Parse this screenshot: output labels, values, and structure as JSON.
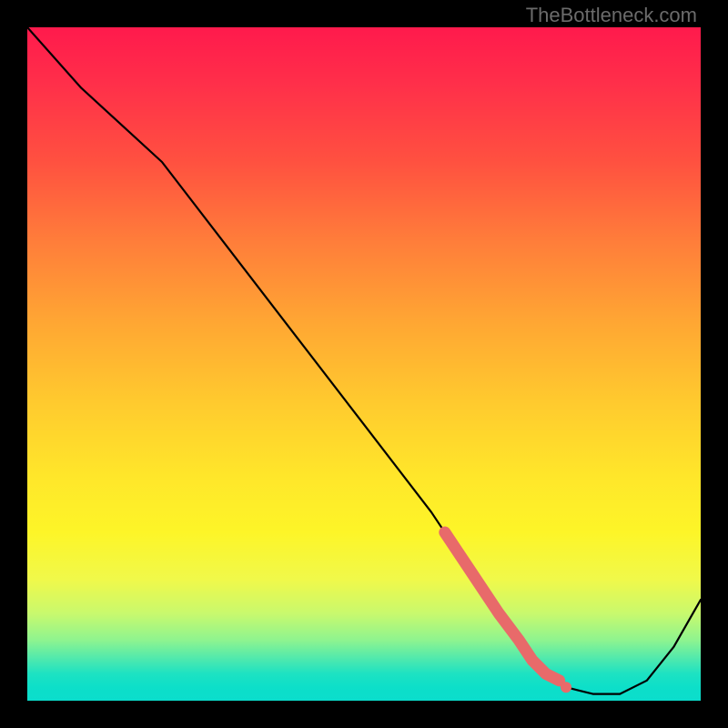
{
  "watermark": "TheBottleneck.com",
  "chart_data": {
    "type": "line",
    "title": "",
    "xlabel": "",
    "ylabel": "",
    "xlim": [
      0,
      100
    ],
    "ylim": [
      0,
      100
    ],
    "series": [
      {
        "name": "bottleneck-curve",
        "x": [
          0,
          8,
          20,
          30,
          40,
          50,
          60,
          68,
          73,
          76,
          80,
          84,
          88,
          92,
          96,
          100
        ],
        "values": [
          100,
          91,
          80,
          67,
          54,
          41,
          28,
          16,
          9,
          5,
          2,
          1,
          1,
          3,
          8,
          15
        ]
      }
    ],
    "highlight_segment": {
      "description": "pink emphasized band on descending part near trough",
      "x": [
        62,
        66,
        70,
        73,
        75,
        77,
        79
      ],
      "values": [
        25,
        19,
        13,
        9,
        6,
        4,
        3
      ]
    },
    "highlight_dots": [
      {
        "x": 73,
        "y": 9
      },
      {
        "x": 77,
        "y": 4
      },
      {
        "x": 80,
        "y": 2
      }
    ],
    "colors": {
      "curve": "#000000",
      "highlight": "#e86a6a",
      "gradient_top": "#ff1a4c",
      "gradient_mid": "#ffe72a",
      "gradient_bottom": "#0bddcc"
    }
  }
}
